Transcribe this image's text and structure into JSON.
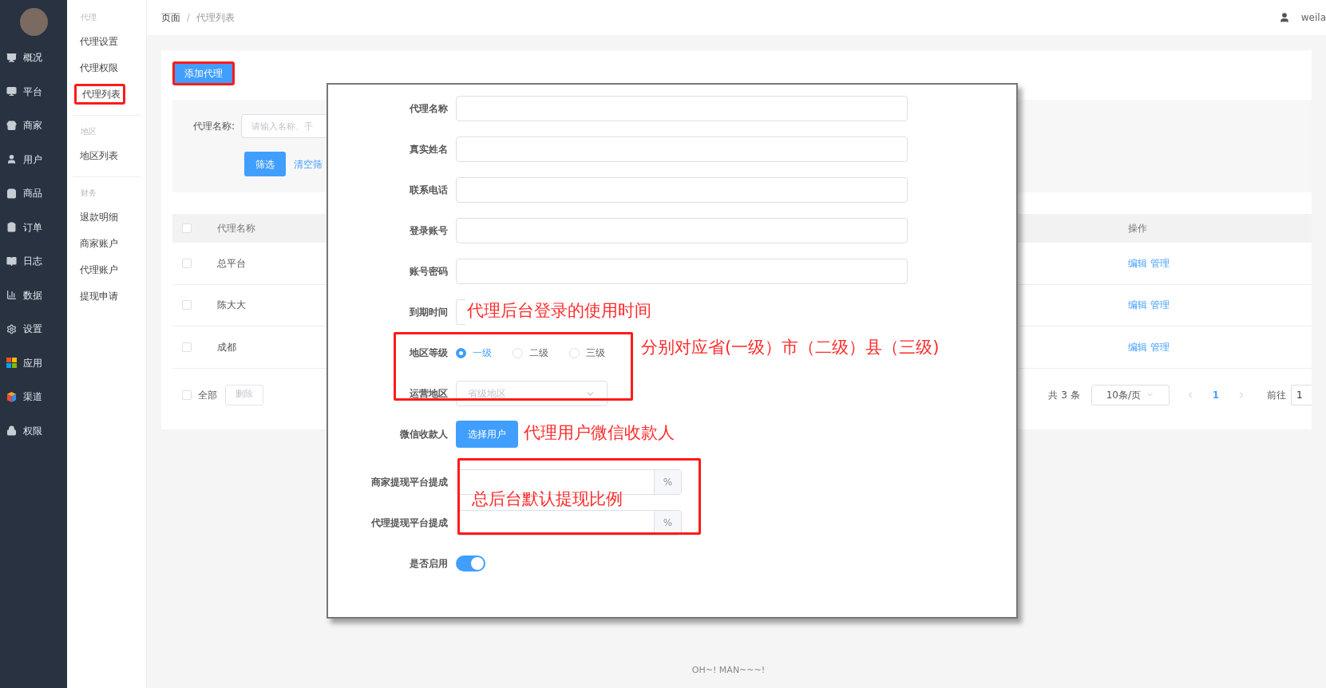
{
  "nav": [
    {
      "label": "概况"
    },
    {
      "label": "平台"
    },
    {
      "label": "商家"
    },
    {
      "label": "用户"
    },
    {
      "label": "商品"
    },
    {
      "label": "订单"
    },
    {
      "label": "日志"
    },
    {
      "label": "数据"
    },
    {
      "label": "设置"
    },
    {
      "label": "应用"
    },
    {
      "label": "渠道"
    },
    {
      "label": "权限"
    }
  ],
  "submenu": [
    {
      "title": "代理",
      "items": [
        {
          "label": "代理设置",
          "highlighted": false
        },
        {
          "label": "代理权限",
          "highlighted": false
        },
        {
          "label": "代理列表",
          "highlighted": true
        }
      ]
    },
    {
      "title": "地区",
      "items": [
        {
          "label": "地区列表",
          "highlighted": false
        }
      ]
    },
    {
      "title": "财务",
      "items": [
        {
          "label": "退款明细",
          "highlighted": false
        },
        {
          "label": "商家账户",
          "highlighted": false
        },
        {
          "label": "代理账户",
          "highlighted": false
        },
        {
          "label": "提现申请",
          "highlighted": false
        }
      ]
    }
  ],
  "breadcrumb": [
    "页面",
    "代理列表"
  ],
  "breadcrumb_separator": "/",
  "user": "weila",
  "add_button": {
    "label": "添加代理",
    "highlighted": true
  },
  "filter": {
    "label": "代理名称:",
    "placeholder": "请输入名称、手",
    "submit": "筛选",
    "clear": "清空筛"
  },
  "table": {
    "columns": [
      "代理名称",
      "操作"
    ],
    "header_checked": false,
    "rows": [
      {
        "checked": false,
        "name": "总平台",
        "actions": [
          "编辑",
          "管理"
        ]
      },
      {
        "checked": false,
        "name": "陈大大",
        "actions": [
          "编辑",
          "管理"
        ]
      },
      {
        "checked": false,
        "name": "成都",
        "actions": [
          "编辑",
          "管理"
        ]
      }
    ]
  },
  "bulk": {
    "checked": false,
    "all": "全部",
    "delete": "删除"
  },
  "pagination": {
    "total": "共 3 条",
    "page_size": "10条/页",
    "pages": [
      {
        "label": "1",
        "selected": true
      }
    ],
    "goto": "前往",
    "goto_value": "1"
  },
  "dialog": {
    "sections": [
      {
        "kind": "basic",
        "fields": [
          {
            "kind": "text",
            "label": "代理名称"
          },
          {
            "kind": "text",
            "label": "真实姓名"
          },
          {
            "kind": "text",
            "label": "联系电话"
          },
          {
            "kind": "text",
            "label": "登录账号"
          },
          {
            "kind": "text",
            "label": "账号密码"
          },
          {
            "kind": "date",
            "label": "到期时间",
            "note": "代理后台登录的使用时间"
          }
        ]
      },
      {
        "kind": "region",
        "framed": true,
        "note": "分别对应省(一级）市（二级）县（三级)",
        "fields": [
          {
            "kind": "radio",
            "label": "地区等级",
            "options": [
              {
                "label": "一级",
                "selected": true
              },
              {
                "label": "二级",
                "selected": false
              },
              {
                "label": "三级",
                "selected": false
              }
            ]
          },
          {
            "kind": "select",
            "label": "运营地区",
            "placeholder": "省级地区"
          }
        ]
      },
      {
        "kind": "payee",
        "fields": [
          {
            "kind": "button",
            "label": "微信收款人",
            "button": "选择用户",
            "note": "代理用户微信收款人"
          }
        ]
      },
      {
        "kind": "rates",
        "framed": true,
        "note": "总后台默认提现比例",
        "fields": [
          {
            "kind": "percent",
            "label": "商家提现平台提成",
            "suffix": "%"
          },
          {
            "kind": "percent",
            "label": "代理提现平台提成",
            "suffix": "%"
          }
        ]
      },
      {
        "kind": "status",
        "fields": [
          {
            "kind": "switch",
            "label": "是否启用",
            "on": true
          }
        ]
      }
    ]
  },
  "footer": "OH~! MAN~~~!"
}
